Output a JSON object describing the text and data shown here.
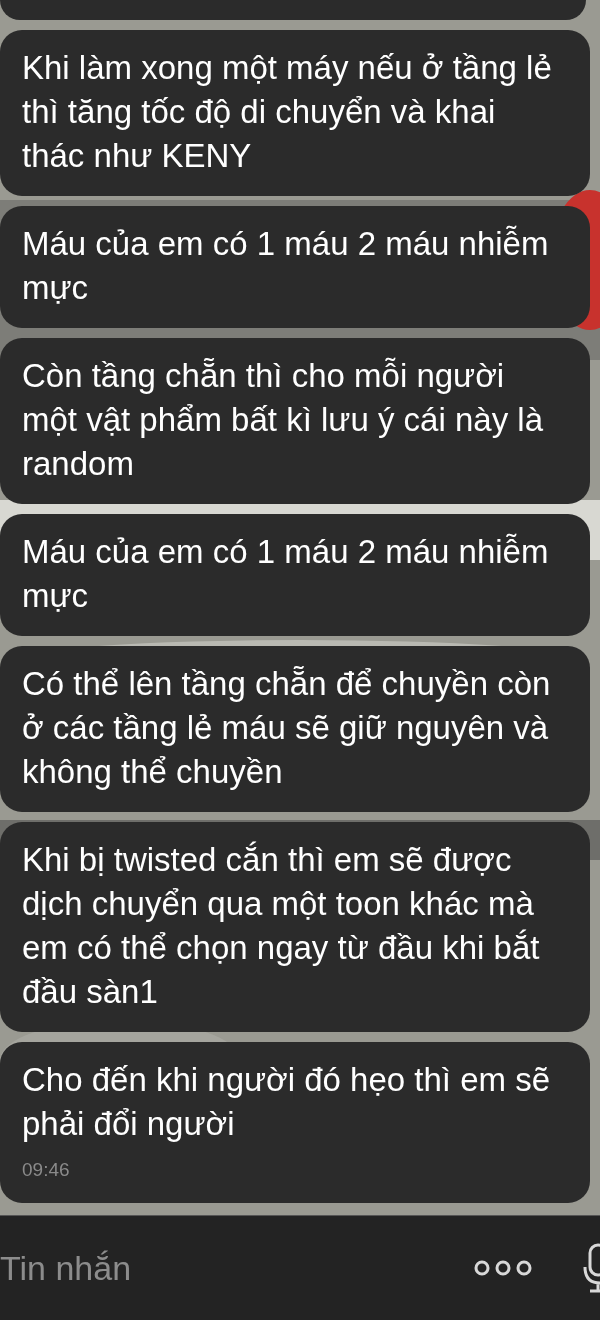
{
  "messages": [
    {
      "text": "Khi làm xong một máy nếu ở tầng lẻ thì tăng tốc độ di chuyển và khai thác như KENY"
    },
    {
      "text": "Máu của em có 1 máu 2 máu nhiễm mực"
    },
    {
      "text": "Còn tầng chẵn thì cho mỗi người một vật phẩm bất kì lưu ý cái này là random"
    },
    {
      "text": "Máu của em có 1 máu 2 máu nhiễm mực"
    },
    {
      "text": "Có thể lên tầng chẵn để chuyền còn ở các tầng lẻ máu sẽ giữ nguyên và không thể chuyền"
    },
    {
      "text": "Khi bị twisted cắn thì em sẽ được dịch chuyển qua một toon khác mà em có thể chọn ngay từ đầu khi bắt đầu sàn1"
    },
    {
      "text": "Cho đến khi người đó hẹo thì em sẽ phải đổi người",
      "time": "09:46"
    }
  ],
  "composer": {
    "placeholder": "Tin nhắn"
  }
}
